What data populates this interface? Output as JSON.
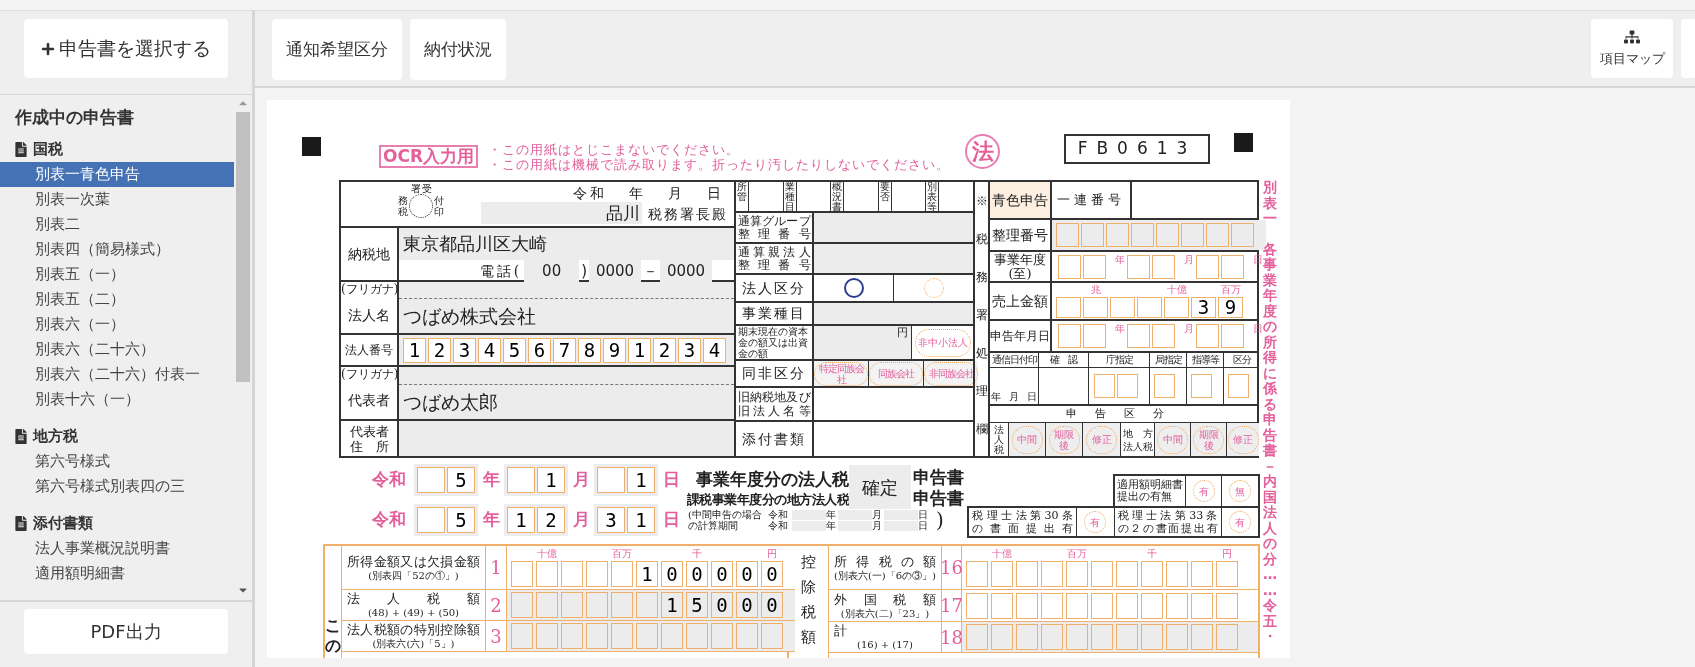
{
  "sidebar": {
    "select_button": "申告書を選択する",
    "heading": "作成中の申告書",
    "groups": [
      {
        "title": "国税",
        "items": [
          {
            "label": "別表一青色申告",
            "selected": true
          },
          {
            "label": "別表一次葉",
            "selected": false
          },
          {
            "label": "別表二",
            "selected": false
          },
          {
            "label": "別表四（簡易様式）",
            "selected": false
          },
          {
            "label": "別表五（一）",
            "selected": false
          },
          {
            "label": "別表五（二）",
            "selected": false
          },
          {
            "label": "別表六（一）",
            "selected": false
          },
          {
            "label": "別表六（二十六）",
            "selected": false
          },
          {
            "label": "別表六（二十六）付表一",
            "selected": false
          },
          {
            "label": "別表十六（一）",
            "selected": false
          }
        ]
      },
      {
        "title": "地方税",
        "items": [
          {
            "label": "第六号様式",
            "selected": false
          },
          {
            "label": "第六号様式別表四の三",
            "selected": false
          }
        ]
      },
      {
        "title": "添付書類",
        "items": [
          {
            "label": "法人事業概況説明書",
            "selected": false
          },
          {
            "label": "適用額明細書",
            "selected": false
          }
        ]
      }
    ],
    "pdf_button": "PDF出力"
  },
  "toolbar": {
    "tabs": [
      "通知希望区分",
      "納付状況"
    ],
    "map_button": "項目マップ"
  },
  "form": {
    "ocr_label": "OCR入力用",
    "notices": [
      "・この用紙はとじこまないでください。",
      "・この用紙は機械で読み取ります。折ったり汚したりしないでください。"
    ],
    "corp_mark": "法",
    "form_code": "FB0613",
    "receipt_stamp": [
      "署",
      "受",
      "務",
      "付",
      "税",
      "印"
    ],
    "date_line": [
      "令和",
      "年",
      "月",
      "日"
    ],
    "tax_office": "品川",
    "tax_office_suffix": "税務署長殿",
    "address_label": "納税地",
    "address": "東京都品川区大崎",
    "phone": {
      "label": "電話(",
      "area": "00",
      "close": ")",
      "local": "0000",
      "sep": "－",
      "number": "0000"
    },
    "name_row": {
      "furigana_label": "(フリガナ)",
      "label": "法人名",
      "value": "つばめ株式会社"
    },
    "number_row": {
      "label": "法人番号",
      "value": "1234567891234"
    },
    "rep_row": {
      "furigana_label": "(フリガナ)",
      "label": "代表者",
      "value": "つばめ太郎"
    },
    "rep_address_label": [
      "代表者",
      "住　所"
    ],
    "office_codes": [
      "所管",
      "業種目",
      "概況書",
      "要否",
      "別表等"
    ],
    "group_number_label": [
      "通算グループ",
      "整理番号"
    ],
    "parent_number_label": [
      "通算親法人",
      "整理番号"
    ],
    "corp_type_label": "法人区分",
    "corp_type_options": [
      {
        "selected": true
      },
      {
        "selected": false
      }
    ],
    "business_label": "事業種目",
    "capital_label": "期末現在の資本金の額又は出資金の額",
    "capital_unit": "円",
    "non_sme_stamp": "非中小法人",
    "family_label": "同非区分",
    "family_options": [
      "特定同族会社",
      "同族会社",
      "非同族会社"
    ],
    "old_address_label": [
      "旧納税地及び",
      "旧法人名等"
    ],
    "attachments_label": "添付書類",
    "office_column": "※税務署処理欄",
    "blue_return": "青色申告",
    "serial_label": "一連番号",
    "ref_label": "整理番号",
    "fiscal_label": [
      "事業年度",
      "(至)"
    ],
    "fiscal_units": [
      "年",
      "月",
      "日"
    ],
    "sales_label": "売上金額",
    "sales_units": [
      "兆",
      "十億",
      "百万"
    ],
    "sales": "39",
    "filed_label": "申告年月日",
    "filed_units": [
      "年",
      "月",
      "日"
    ],
    "office_headers": [
      "通信日付印",
      "確　認",
      "庁指定",
      "局指定",
      "指導等",
      "区分"
    ],
    "office_date": [
      "年",
      "月",
      "日"
    ],
    "filing_kind_label": "申告区分",
    "filing_groups": [
      {
        "kind": "vertical",
        "lines": [
          "法人税"
        ],
        "stamps": [
          "中間",
          "期限後",
          "修正"
        ]
      },
      {
        "kind": "stacked",
        "lines": [
          "地　方",
          "法人税"
        ],
        "stamps": [
          "中間",
          "期限後",
          "修正"
        ]
      }
    ],
    "period": [
      {
        "era": "令和",
        "year": "5",
        "year_unit": "年",
        "month": "1",
        "month_unit": "月",
        "day": "1",
        "day_unit": "日"
      },
      {
        "era": "令和",
        "year": "5",
        "year_unit": "年",
        "month": "12",
        "month_unit": "月",
        "day": "31",
        "day_unit": "日"
      }
    ],
    "titles": [
      "事業年度分の法人税",
      "課税事業年度分の地方法人税"
    ],
    "return_type": "確定",
    "return_suffixes": [
      "申告書",
      "申告書"
    ],
    "interim": {
      "note": [
        "(中間申告の場合",
        "の計算期間"
      ],
      "rows": [
        [
          "令和",
          "年",
          "月",
          "日"
        ],
        [
          "令和",
          "年",
          "月",
          "日"
        ]
      ],
      "close": ")"
    },
    "statement": {
      "lines": [
        "適用額明細書",
        "提出の有無"
      ],
      "options": [
        "有",
        "無"
      ]
    },
    "advisors": [
      {
        "lines": [
          "税理士法第30条",
          "の書面提出有"
        ],
        "option": "有"
      },
      {
        "lines": [
          "税理士法第33条",
          "の２の書面提出有"
        ],
        "option": "有"
      }
    ],
    "section_label": "この",
    "income_scale": [
      "十億",
      "百万",
      "千",
      "円"
    ],
    "income_rows": [
      {
        "label": "所得金額又は欠損金額",
        "note": "(別表四「52の①」)",
        "no": "1",
        "value": "100000",
        "computed": false
      },
      {
        "label": "法人税額",
        "note": "(48) + (49) + (50)",
        "no": "2",
        "value": "15000",
        "computed": true
      },
      {
        "label": "法人税額の特別控除額",
        "note": "(別表六(六)「5」)",
        "no": "3",
        "value": "",
        "computed": true
      }
    ],
    "credit_label": "控除税額",
    "credit_scale": [
      "十億",
      "百万",
      "千",
      "円"
    ],
    "credit_rows": [
      {
        "label": "所得税の額",
        "note": "(別表六(一)「6の③」)",
        "no": "16",
        "value": "",
        "computed": false
      },
      {
        "label": "外国税額",
        "note": "(別表六(二)「23」)",
        "no": "17",
        "value": "",
        "computed": false
      },
      {
        "label": "計",
        "note": "(16) + (17)",
        "no": "18",
        "value": "",
        "computed": true
      }
    ],
    "side_title": [
      "別表一",
      "各事業年度の所得に係る申告書－内国法人の分……令五・"
    ]
  }
}
